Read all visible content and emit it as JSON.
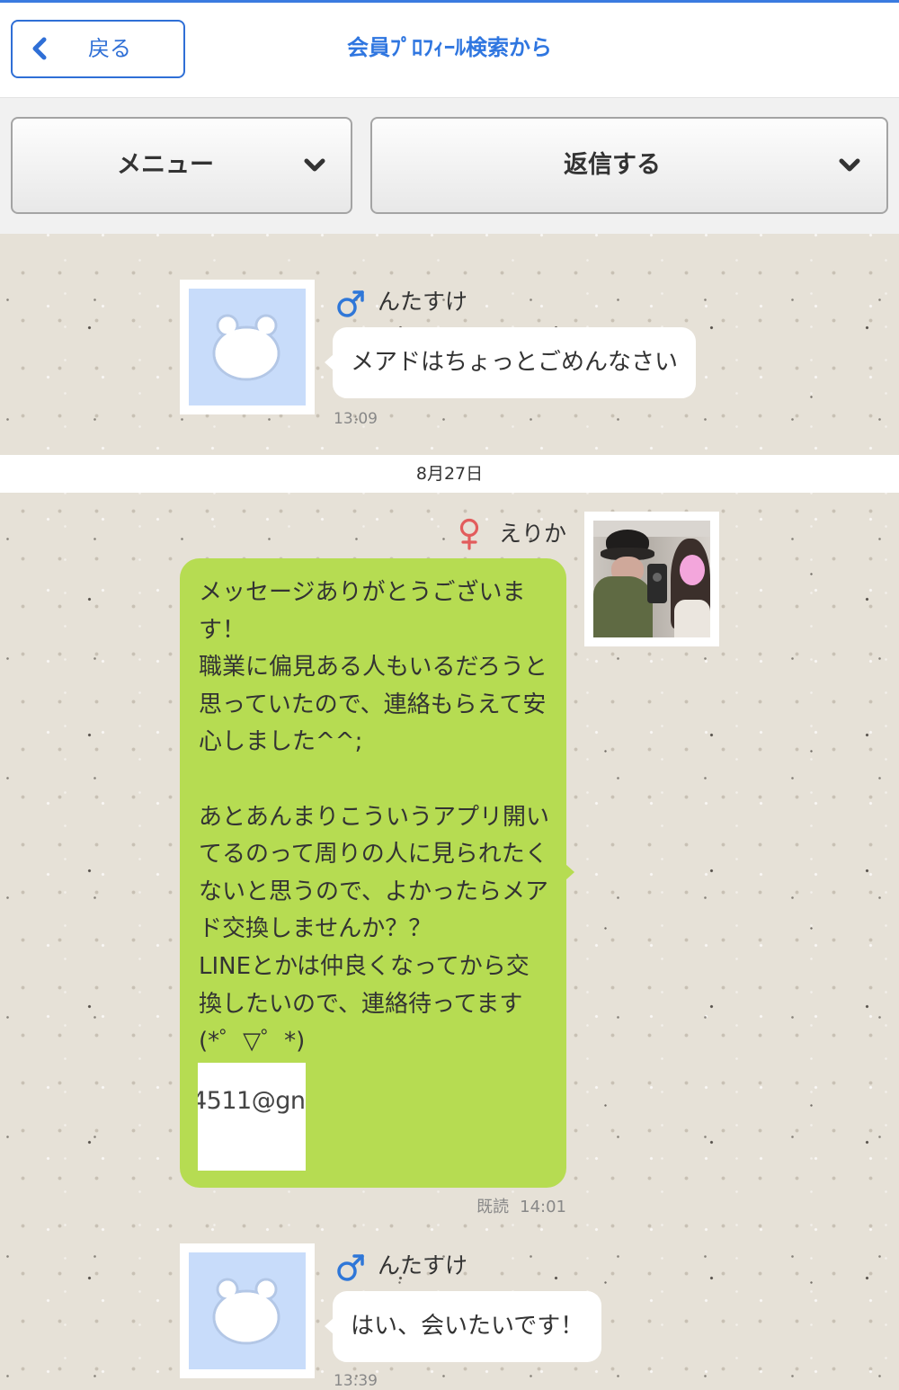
{
  "header": {
    "back_icon": "chevron-left-icon",
    "back_label": "戻る",
    "title": "会員ﾌﾟﾛﾌｨｰﾙ検索から"
  },
  "toolbar": {
    "menu_label": "メニュー",
    "menu_icon": "chevron-down-icon",
    "reply_label": "返信する",
    "reply_icon": "chevron-down-icon"
  },
  "date_separator": "8月27日",
  "messages": [
    {
      "sender": "んたすけ",
      "gender_icon": "male-icon",
      "avatar_icon": "bear-placeholder-icon",
      "text": "メアドはちょっとごめんなさい",
      "time": "13:09"
    },
    {
      "sender": "えりか",
      "gender_icon": "female-icon",
      "paragraphs": [
        [
          "メッセージありがとうございま",
          "す！",
          "職業に偏見ある人もいるだろうと",
          "思っていたので、連絡もらえて安",
          "心しました^^;"
        ],
        [
          "あとあんまりこういうアプリ開い",
          "てるのって周りの人に見られたく",
          "ないと思うので、よかったらメア",
          "ド交換しませんか？？",
          "LINEとかは仲良くなってから交",
          "換したいので、連絡待ってます",
          "(*゜▽゜*)"
        ]
      ],
      "attachment_text": "4511@gn",
      "read_label": "既読",
      "time": "14:01"
    },
    {
      "sender": "んたすけ",
      "gender_icon": "male-icon",
      "avatar_icon": "bear-placeholder-icon",
      "text": "はい、会いたいです！",
      "time": "13:39"
    }
  ],
  "colors": {
    "accent": "#2f76e0",
    "male": "#2f77d8",
    "female": "#e25c5c",
    "bubble_white": "#ffffff",
    "bubble_green": "#b6dc52",
    "chat_background": "#e6e1d7",
    "avatar_placeholder": "#c8dcfa"
  }
}
